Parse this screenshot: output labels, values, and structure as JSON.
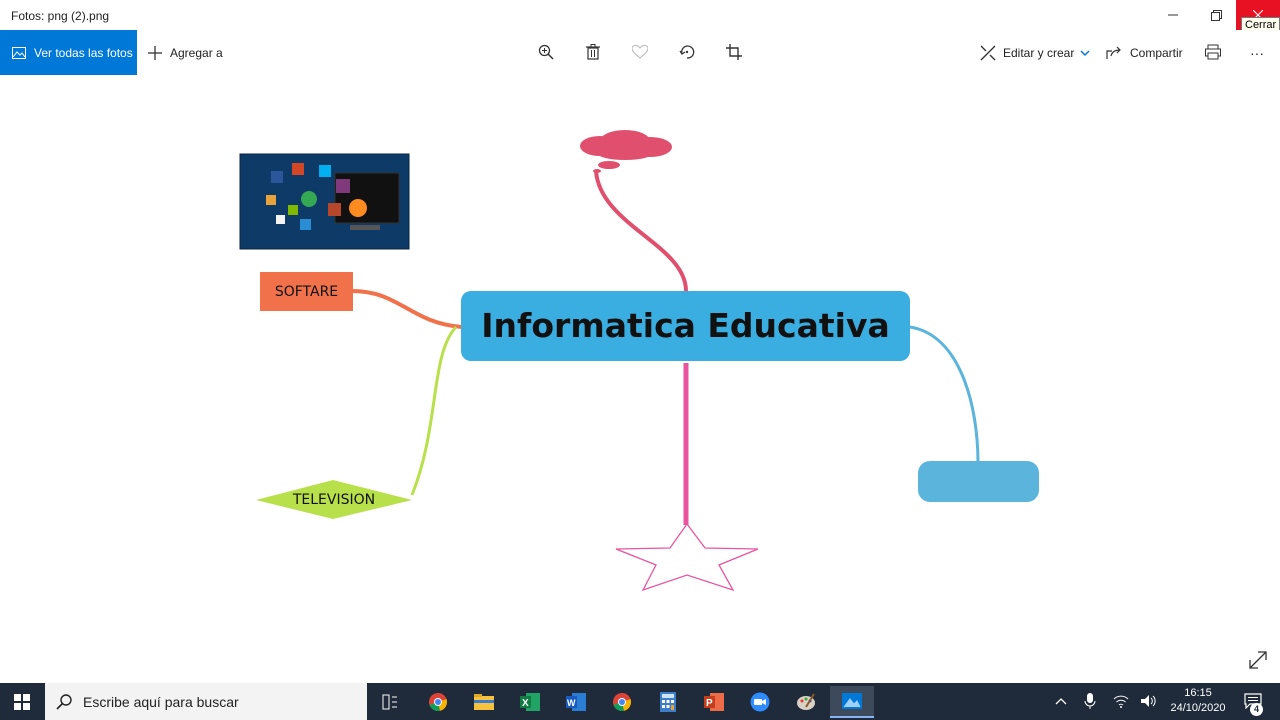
{
  "window": {
    "title": "Fotos: png (2).png",
    "close_tooltip": "Cerrar"
  },
  "toolbar": {
    "all_photos_label": "Ver todas las fotos",
    "add_to_label": "Agregar a",
    "edit_create_label": "Editar y crear",
    "share_label": "Compartir",
    "more_label": "···"
  },
  "mindmap": {
    "central_topic": "Informatica Educativa",
    "nodes": {
      "software": "SOFTARE",
      "television": "TELEVISION"
    },
    "colors": {
      "central": "#3aaee0",
      "software": "#f0714a",
      "television": "#b8e04a",
      "cloud": "#e0506e",
      "blue_node": "#5ab4dc",
      "star": "#e8559e"
    }
  },
  "taskbar": {
    "search_placeholder": "Escribe aquí para buscar",
    "time": "16:15",
    "date": "24/10/2020",
    "notification_count": "4",
    "apps": [
      "task-view",
      "chrome",
      "file-explorer",
      "excel",
      "word",
      "chrome",
      "calculator",
      "powerpoint",
      "zoom",
      "paint",
      "photos"
    ]
  }
}
